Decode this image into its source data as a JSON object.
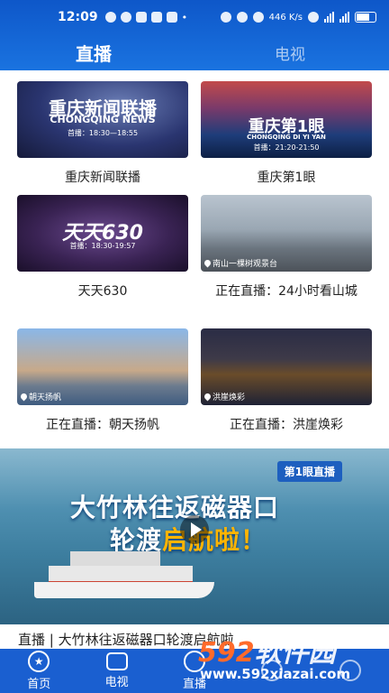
{
  "status_bar": {
    "time": "12:09",
    "network_speed": "446 K/s",
    "battery_icon": "battery-icon"
  },
  "header": {
    "tabs": [
      {
        "label": "直播"
      },
      {
        "label": "电视"
      }
    ]
  },
  "channels": [
    {
      "caption": "重庆新闻联播",
      "logo": "重庆新闻联播",
      "logo_sub": "CHONGQING NEWS",
      "schedule": "首播：18:30—18:55"
    },
    {
      "caption": "重庆第1眼",
      "logo": "重庆第1眼",
      "logo_sub": "CHONGQING DI YI YAN",
      "schedule": "首播：21:20-21:50"
    },
    {
      "caption": "天天630",
      "logo": "天天630",
      "schedule": "首播：18:30-19:57"
    },
    {
      "caption": "正在直播：24小时看山城",
      "location": "南山一棵树观景台"
    },
    {
      "caption": "正在直播：朝天扬帆",
      "location": "朝天扬帆"
    },
    {
      "caption": "正在直播：洪崖焕彩",
      "location": "洪崖焕彩"
    }
  ],
  "banner": {
    "badge": "第1眼直播",
    "line1": "大竹林往返磁器口",
    "line2_a": "轮渡",
    "line2_b": "启航啦！",
    "title": "直播 | 大竹林往返磁器口轮渡启航啦"
  },
  "tabbar": {
    "items": [
      {
        "label": "首页"
      },
      {
        "label": "电视"
      },
      {
        "label": "直播"
      },
      {
        "label": ""
      },
      {
        "label": ""
      }
    ]
  },
  "watermark": {
    "brand_num": "592",
    "brand_text": "软件园",
    "url": "www.592xiazai.com"
  },
  "colors": {
    "primary_blue": "#1a5fd0",
    "header_blue": "#0e57c9",
    "accent_orange": "#ffb400"
  }
}
